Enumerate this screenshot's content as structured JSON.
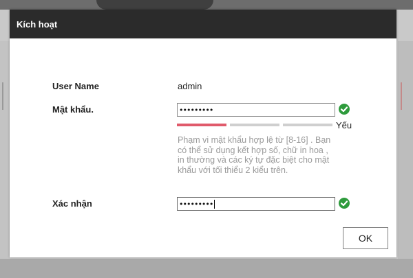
{
  "dialog": {
    "title": "Kích hoạt",
    "username_label": "User Name",
    "username_value": "admin",
    "password_label": "Mật khẩu.",
    "password_value": "•••••••••",
    "strength_label": "Yếu",
    "strength_level": "1 of 3",
    "hint": "Phạm vi mật khẩu hợp lệ từ [8-16] . Bạn có thể sử dụng kết hợp số, chữ in hoa , in thường và các ký tự đặc biệt cho mật khẩu với tối thiểu 2 kiểu trên.",
    "confirm_label": "Xác nhận",
    "confirm_value": "•••••••••",
    "ok_label": "OK"
  },
  "icons": {
    "password_valid": "check-circle-icon",
    "confirm_valid": "check-circle-icon"
  },
  "colors": {
    "header_bg": "#2b2b2b",
    "check_green": "#2e9b3c",
    "strength_weak": "#e05a6b",
    "strength_empty": "#cfcfcf"
  }
}
